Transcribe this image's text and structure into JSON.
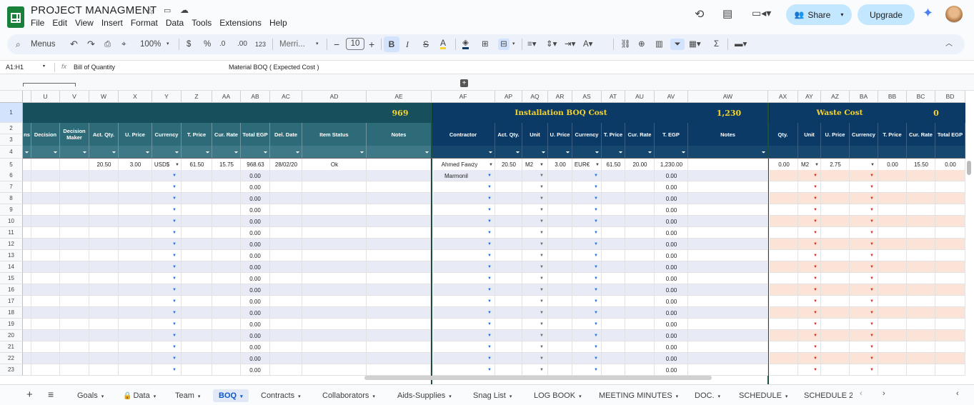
{
  "app": {
    "title": "PROJECT MANAGMENT",
    "menus": [
      "File",
      "Edit",
      "View",
      "Insert",
      "Format",
      "Data",
      "Tools",
      "Extensions",
      "Help"
    ],
    "share_label": "Share",
    "upgrade_label": "Upgrade"
  },
  "toolbar": {
    "search_label": "Menus",
    "zoom": "100%",
    "currency_symbol": "$",
    "percent_symbol": "%",
    "dec_decrease": ".0",
    "dec_increase": ".00",
    "number_format": "123",
    "font": "Merri...",
    "font_size": "10",
    "bold": "B",
    "italic": "I",
    "strike": "S",
    "text_color": "A"
  },
  "formula": {
    "cell_ref": "A1:H1",
    "fx": "fx",
    "content": "Bill of Quantity",
    "overflow_text": "Material BOQ ( Expected  Cost )"
  },
  "columns": [
    "U",
    "V",
    "W",
    "X",
    "Y",
    "Z",
    "AA",
    "AB",
    "AC",
    "AD",
    "AE",
    "AF",
    "AP",
    "AQ",
    "AR",
    "AS",
    "AT",
    "AU",
    "AV",
    "AW",
    "AX",
    "AY",
    "AZ",
    "BA",
    "BB",
    "BC",
    "BD"
  ],
  "banners": {
    "material_total": "969",
    "installation_title": "Installation BOQ Cost",
    "installation_total": "1,230",
    "waste_title": "Waste Cost",
    "waste_total": "0"
  },
  "headers": {
    "partial": "ns",
    "material": [
      "Decision",
      "Decision Maker",
      "Act. Qty.",
      "U. Price",
      "Currency",
      "T. Price",
      "Cur. Rate",
      "Total EGP",
      "Del. Date",
      "Item Status",
      "Notes"
    ],
    "installation": [
      "Contractor",
      "Act. Qty.",
      "Unit",
      "U. Price",
      "Currency",
      "T. Price",
      "Cur. Rate",
      "T. EGP",
      "Notes"
    ],
    "waste": [
      "Qty.",
      "Unit",
      "U. Price",
      "Currency",
      "T. Price",
      "Cur. Rate",
      "Total EGP"
    ]
  },
  "row_numbers": [
    "1",
    "2",
    "3",
    "4",
    "5",
    "6",
    "7",
    "8",
    "9",
    "10",
    "11",
    "12",
    "13",
    "14",
    "15",
    "16",
    "17",
    "18",
    "19",
    "20",
    "21",
    "22",
    "23"
  ],
  "row5": {
    "act_qty": "20.50",
    "u_price": "3.00",
    "currency": "USD$",
    "t_price": "61.50",
    "cur_rate": "15.75",
    "total_egp": "968.63",
    "del_date": "28/02/20",
    "item_status": "Ok",
    "contractor": "Ahmed Fawzy",
    "inst_qty": "20.50",
    "inst_unit": "M2",
    "inst_u_price": "3.00",
    "inst_currency": "EUR€",
    "inst_t_price": "61.50",
    "inst_cur_rate": "20.00",
    "inst_t_egp": "1,230.00",
    "waste_qty": "0.00",
    "waste_unit": "M2",
    "waste_u_price": "2.75",
    "waste_t_price": "0.00",
    "waste_cur_rate": "15.50",
    "waste_total": "0.00"
  },
  "row6_contractor": "Marmonil",
  "zero_value": "0.00",
  "sheet_tabs": [
    {
      "label": "Goals",
      "active": false,
      "locked": false
    },
    {
      "label": "Data",
      "active": false,
      "locked": true
    },
    {
      "label": "Team",
      "active": false,
      "locked": false
    },
    {
      "label": "BOQ",
      "active": true,
      "locked": false
    },
    {
      "label": "Contracts",
      "active": false,
      "locked": false
    },
    {
      "label": "Collaborators",
      "active": false,
      "locked": false
    },
    {
      "label": "Aids-Supplies",
      "active": false,
      "locked": false
    },
    {
      "label": "Snag List",
      "active": false,
      "locked": false
    },
    {
      "label": "LOG BOOK",
      "active": false,
      "locked": false
    },
    {
      "label": "MEETING MINUTES",
      "active": false,
      "locked": false
    },
    {
      "label": "DOC.",
      "active": false,
      "locked": false
    },
    {
      "label": "SCHEDULE",
      "active": false,
      "locked": false
    },
    {
      "label": "SCHEDULE 2",
      "active": false,
      "locked": false
    }
  ],
  "colors": {
    "teal_header": "#2e6b78",
    "teal_dark": "#174f5c",
    "navy_header": "#0b3a66",
    "gold_text": "#f6d32d",
    "band_purple": "#e8eaf6",
    "band_peach": "#fce3d8",
    "accent_blue": "#c2e7ff"
  }
}
